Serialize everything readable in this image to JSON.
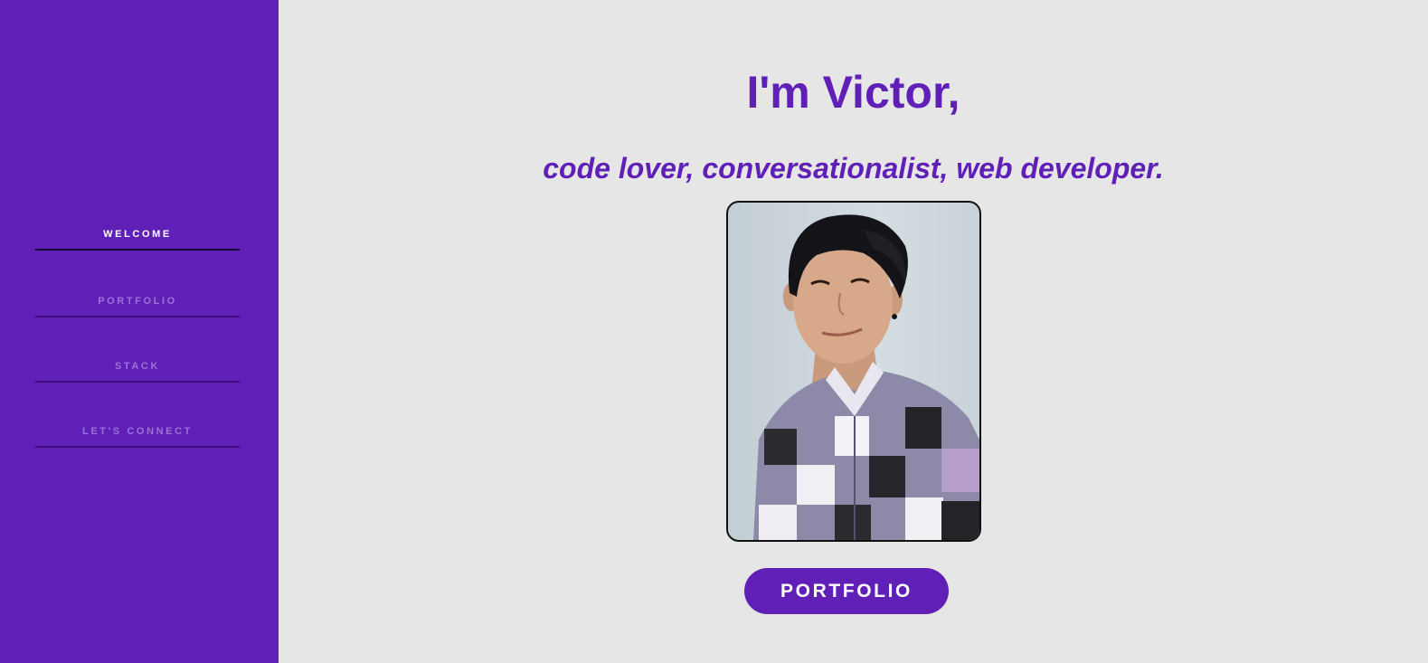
{
  "colors": {
    "accent": "#6020b8",
    "background": "#e6e6e6",
    "nav_active_text": "#ffffff",
    "nav_inactive_text": "#9b72d6"
  },
  "sidebar": {
    "items": [
      {
        "label": "WELCOME",
        "active": true
      },
      {
        "label": "PORTFOLIO",
        "active": false
      },
      {
        "label": "STACK",
        "active": false
      },
      {
        "label": "LET'S CONNECT",
        "active": false
      }
    ]
  },
  "hero": {
    "title": "I'm Victor,",
    "subtitle": "code lover, conversationalist, web developer.",
    "photo_icon": "portrait-photo",
    "cta_label": "PORTFOLIO"
  }
}
